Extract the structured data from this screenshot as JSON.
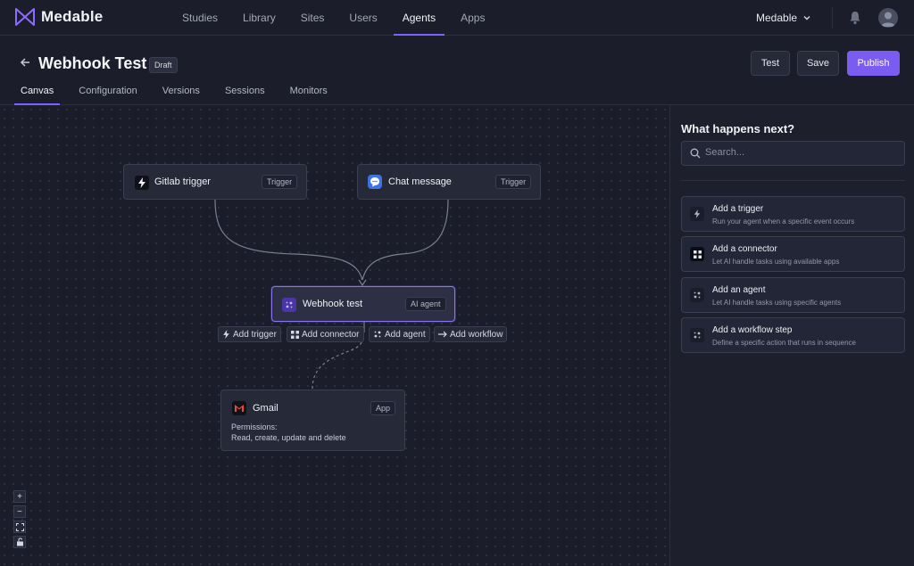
{
  "brand": {
    "name": "Medable"
  },
  "nav": {
    "items": [
      "Studies",
      "Library",
      "Sites",
      "Users",
      "Agents",
      "Apps"
    ],
    "active": "Agents"
  },
  "org_switcher": {
    "label": "Medable"
  },
  "page": {
    "title": "Webhook Test",
    "status_badge": "Draft"
  },
  "actions": {
    "test": "Test",
    "save": "Save",
    "publish": "Publish"
  },
  "tabs": [
    "Canvas",
    "Configuration",
    "Versions",
    "Sessions",
    "Monitors"
  ],
  "canvas": {
    "nodes": {
      "gitlab": {
        "label": "Gitlab trigger",
        "tag": "Trigger"
      },
      "chat": {
        "label": "Chat message",
        "tag": "Trigger"
      },
      "agent": {
        "label": "Webhook test",
        "tag": "AI agent"
      },
      "gmail": {
        "label": "Gmail",
        "tag": "App",
        "permissions_label": "Permissions:",
        "permissions_value": "Read, create, update and delete"
      }
    },
    "add_actions": {
      "trigger": "Add trigger",
      "connector": "Add connector",
      "agent": "Add agent",
      "workflow": "Add workflow"
    },
    "zoom_controls": [
      "+",
      "−"
    ]
  },
  "panel": {
    "title": "What happens next?",
    "search_placeholder": "Search...",
    "options": [
      {
        "title": "Add a trigger",
        "desc": "Run your agent when a specific event occurs",
        "icon": "lightning-icon"
      },
      {
        "title": "Add a connector",
        "desc": "Let AI handle tasks using available apps",
        "icon": "grid-icon"
      },
      {
        "title": "Add an agent",
        "desc": "Let AI handle tasks using specific agents",
        "icon": "sparkle-icon"
      },
      {
        "title": "Add a workflow step",
        "desc": "Define a specific action that runs in sequence",
        "icon": "sparkle-icon"
      }
    ]
  },
  "colors": {
    "accent": "#7b5cf0",
    "background": "#1b1d2a"
  }
}
